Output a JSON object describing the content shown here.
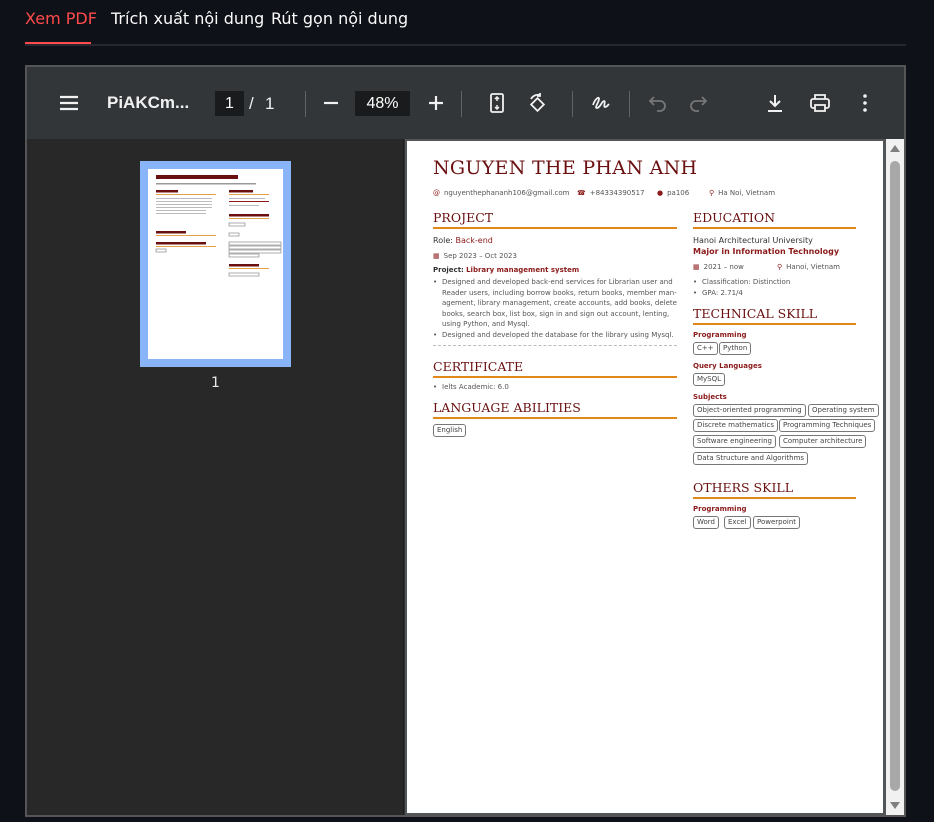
{
  "tabs": [
    {
      "label": "Xem PDF",
      "active": true
    },
    {
      "label": "Trích xuất nội dung",
      "active": false
    },
    {
      "label": "Rút gọn nội dung",
      "active": false
    }
  ],
  "toolbar": {
    "title": "PiAKCm...",
    "current_page": "1",
    "page_separator": "/",
    "total_pages": "1",
    "zoom": "48%"
  },
  "sidebar": {
    "thumbnail_number": "1"
  },
  "cv": {
    "name": "NGUYEN THE PHAN ANH",
    "email": "nguyenthephananh106@gmail.com",
    "phone": "+84334390517",
    "github": "pa106",
    "location": "Ha Noi, Vietnam",
    "project": {
      "title": "PROJECT",
      "role_label": "Role:",
      "role": "Back-end",
      "dates": "Sep 2023 – Oct 2023",
      "project_label": "Project:",
      "project_name": "Library management system",
      "bullets": [
        "Designed and developed back-end services for Librarian user and Reader users, including borrow books, return books, member man-agement, library management, create accounts, add books, delete books, search box, list box, sign in and sign out account, lenting, using Python, and Mysql.",
        "Designed and developed the database for the library using Mysql."
      ]
    },
    "certificate": {
      "title": "CERTIFICATE",
      "bullets": [
        "Ielts Academic: 6.0"
      ]
    },
    "language": {
      "title": "LANGUAGE ABILITIES",
      "tags": [
        "English"
      ]
    },
    "education": {
      "title": "EDUCATION",
      "school": "Hanoi Architectural University",
      "major": "Major in Information Technology",
      "dates": "2021 – now",
      "location": "Hanoi, Vietnam",
      "bullets": [
        "Classification: Distinction",
        "GPA: 2.71/4"
      ]
    },
    "technical": {
      "title": "TECHNICAL SKILL",
      "programming_label": "Programming",
      "programming": [
        "C++",
        "Python"
      ],
      "query_label": "Query Languages",
      "query": [
        "MySQL"
      ],
      "subjects_label": "Subjects",
      "subjects": [
        "Object-oriented programming",
        "Operating system",
        "Discrete mathematics",
        "Programming Techniques",
        "Software engineering",
        "Computer architecture",
        "Data Structure and Algorithms"
      ]
    },
    "others": {
      "title": "OTHERS SKILL",
      "programming_label": "Programming",
      "tools": [
        "Word",
        "Excel",
        "Powerpoint"
      ]
    }
  },
  "colors": {
    "tab_active": "#ff4b4b",
    "heading": "#6b1010",
    "rule": "#e0891a",
    "thumb_highlight": "#8ab4f8"
  }
}
